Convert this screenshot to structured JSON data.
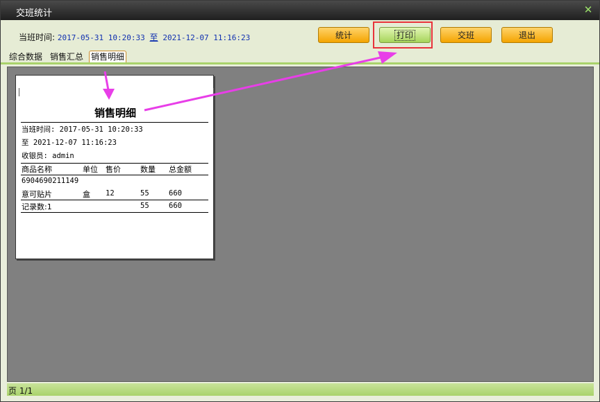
{
  "window": {
    "title": "交班统计"
  },
  "toolbar": {
    "range_label": "当班时间:",
    "start_time": "2017-05-31 10:20:33",
    "to_label": "至",
    "end_time": "2021-12-07 11:16:23",
    "buttons": {
      "stats": "统计",
      "print": "打印",
      "handover": "交班",
      "exit": "退出"
    }
  },
  "tabs": [
    "综合数据",
    "销售汇总",
    "销售明细"
  ],
  "receipt": {
    "title": "销售明细",
    "shift_line": "当班时间: 2017-05-31 10:20:33",
    "to_line": "至 2021-12-07 11:16:23",
    "cashier_line": "收银员: admin",
    "headers": [
      "商品名称",
      "单位",
      "售价",
      "数量",
      "总金额"
    ],
    "barcode": "6904690211149",
    "item": {
      "name": "意可贴片",
      "unit": "盒",
      "price": "12",
      "qty": "55",
      "total": "660"
    },
    "summary": {
      "label": "记录数:1",
      "qty": "55",
      "total": "660"
    }
  },
  "status": {
    "page": "页 1/1"
  },
  "colors": {
    "annotation_arrow": "#e83ee8",
    "annotation_box": "#e8323a",
    "button_orange": "#f4a400",
    "button_green": "#a6d45a"
  }
}
